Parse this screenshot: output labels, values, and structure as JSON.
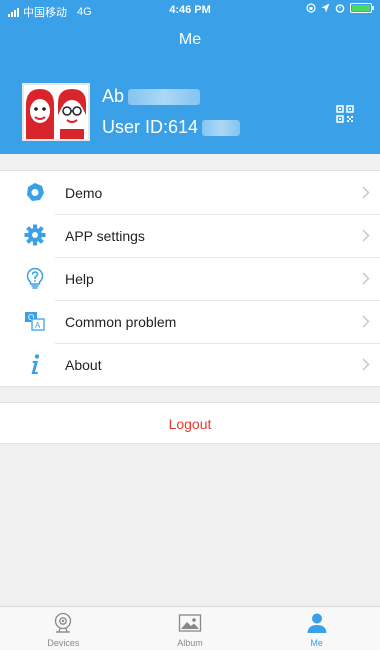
{
  "status_bar": {
    "carrier": "中国移动",
    "network": "4G",
    "time": "4:46 PM"
  },
  "nav": {
    "title": "Me"
  },
  "profile": {
    "name_visible": "Ab",
    "user_id_visible": "User ID:614"
  },
  "menu": [
    {
      "label": "Demo",
      "icon": "demo-icon"
    },
    {
      "label": "APP settings",
      "icon": "gear-icon"
    },
    {
      "label": "Help",
      "icon": "help-bulb-icon"
    },
    {
      "label": "Common problem",
      "icon": "common-problem-icon"
    },
    {
      "label": "About",
      "icon": "info-icon"
    }
  ],
  "logout_label": "Logout",
  "tabs": [
    {
      "label": "Devices",
      "icon": "camera-icon",
      "active": false
    },
    {
      "label": "Album",
      "icon": "album-icon",
      "active": false
    },
    {
      "label": "Me",
      "icon": "person-icon",
      "active": true
    }
  ],
  "colors": {
    "primary": "#3aa0e8",
    "logout": "#e63b2e",
    "background": "#f0f0f0",
    "battery": "#4cd964"
  }
}
